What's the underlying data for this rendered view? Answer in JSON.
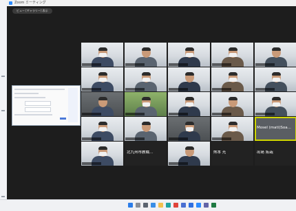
{
  "window": {
    "title": "Zoom ミーティング",
    "pill": "ビュー [ギャラリー] 表示"
  },
  "gallery": {
    "tiles": [
      {
        "name": "",
        "style": "office",
        "person": true
      },
      {
        "name": "",
        "style": "office",
        "person": true
      },
      {
        "name": "",
        "style": "office",
        "person": true
      },
      {
        "name": "",
        "style": "office",
        "person": true
      },
      {
        "name": "",
        "style": "office",
        "person": true
      },
      {
        "name": "",
        "style": "office",
        "person": true
      },
      {
        "name": "",
        "style": "office",
        "person": true
      },
      {
        "name": "",
        "style": "office",
        "person": true
      },
      {
        "name": "",
        "style": "office",
        "person": true
      },
      {
        "name": "",
        "style": "office",
        "person": true
      },
      {
        "name": "",
        "style": "dark",
        "person": true
      },
      {
        "name": "",
        "style": "green",
        "person": true
      },
      {
        "name": "",
        "style": "office",
        "person": true
      },
      {
        "name": "",
        "style": "office",
        "person": true
      },
      {
        "name": "",
        "style": "office",
        "person": true
      },
      {
        "name": "",
        "style": "office",
        "person": true
      },
      {
        "name": "",
        "style": "office",
        "person": true
      },
      {
        "name": "",
        "style": "dark",
        "person": true
      },
      {
        "name": "",
        "style": "office",
        "person": true
      },
      {
        "name": "Mosel (mati)Soa...",
        "style": "gray",
        "person": false,
        "big": true,
        "highlight": true
      },
      {
        "name": "",
        "style": "office",
        "person": true
      },
      {
        "name": "北九州市教職...",
        "style": "blank",
        "person": false,
        "big": true
      },
      {
        "name": "",
        "style": "office",
        "person": true
      },
      {
        "name": "熊本 光",
        "style": "blank",
        "person": false,
        "big": true
      },
      {
        "name": "出島 拓哉",
        "style": "blank",
        "person": false,
        "big": true
      }
    ]
  },
  "taskbar": {
    "icons": [
      {
        "name": "windows-start-icon",
        "color": "#2b7de9"
      },
      {
        "name": "search-icon",
        "color": "#8a8f98"
      },
      {
        "name": "task-view-icon",
        "color": "#5b6470"
      },
      {
        "name": "widgets-icon",
        "color": "#3a8ee6"
      },
      {
        "name": "file-explorer-icon",
        "color": "#f2c14e"
      },
      {
        "name": "edge-icon",
        "color": "#1fa3a0"
      },
      {
        "name": "chrome-icon",
        "color": "#e0453a"
      },
      {
        "name": "store-icon",
        "color": "#4a6fd1"
      },
      {
        "name": "mail-icon",
        "color": "#2f6fe0"
      },
      {
        "name": "zoom-icon",
        "color": "#2d8cff"
      },
      {
        "name": "teams-icon",
        "color": "#6264a7"
      },
      {
        "name": "excel-icon",
        "color": "#1f7a43"
      }
    ]
  }
}
